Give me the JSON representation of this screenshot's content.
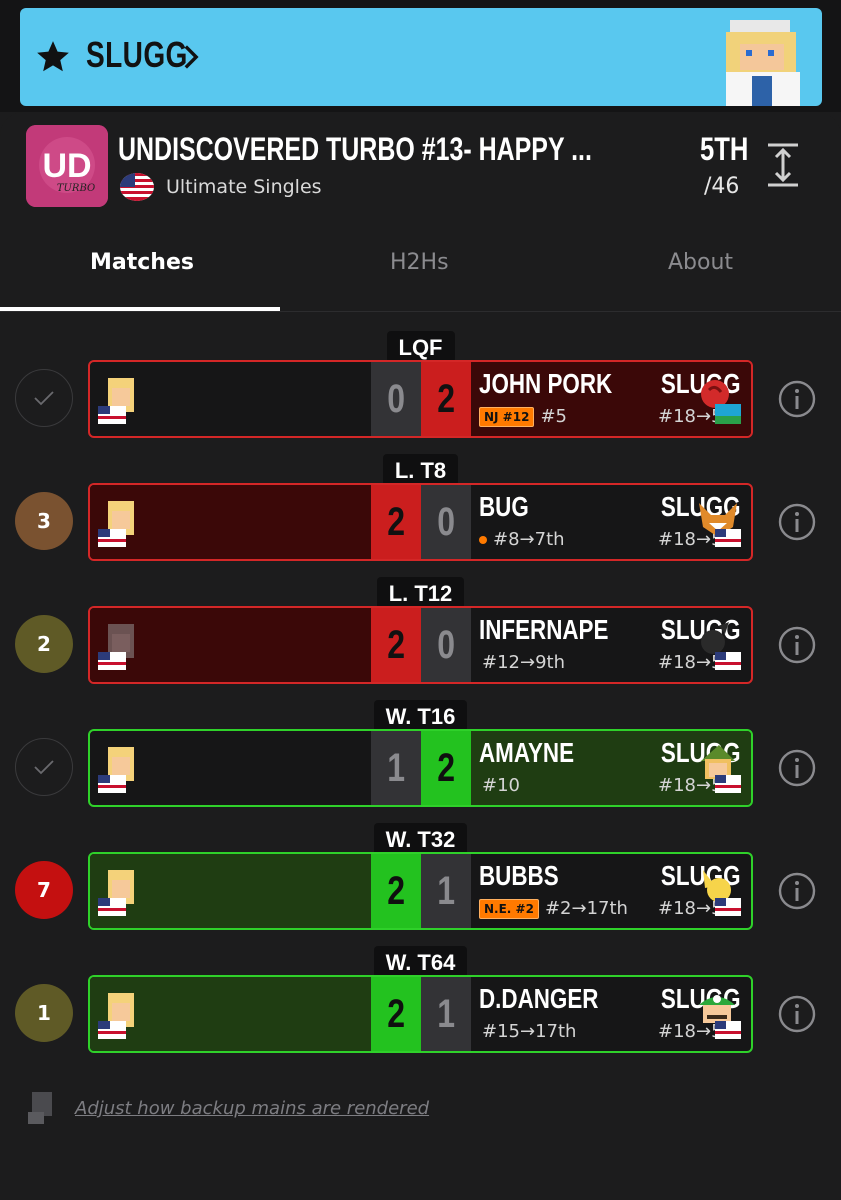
{
  "banner": {
    "name": "SLUGG"
  },
  "event": {
    "logo_text": "UD",
    "logo_sub": "TURBO",
    "title": "UNDISCOVERED TURBO #13- HAPPY ...",
    "game": "Ultimate Singles",
    "place": "5TH",
    "total": "/46"
  },
  "tabs": [
    {
      "label": "Matches",
      "active": true
    },
    {
      "label": "H2Hs",
      "active": false
    },
    {
      "label": "About",
      "active": false
    }
  ],
  "matches": [
    {
      "round": "LQF",
      "indicator": "",
      "indicator_color": "",
      "result": "loss",
      "left": {
        "name": "SLUGG",
        "seed": "#18→5th",
        "score": "0"
      },
      "right": {
        "name": "JOHN PORK",
        "tag": "NJ #12",
        "seed": "#5",
        "score": "2"
      }
    },
    {
      "round": "L. T8",
      "indicator": "3",
      "indicator_color": "#7a5230",
      "result": "win",
      "left": {
        "name": "SLUGG",
        "seed": "#18→5th",
        "score": "2"
      },
      "right": {
        "name": "BUG",
        "tag": "",
        "seed": "#8→7th",
        "score": "0"
      }
    },
    {
      "round": "L. T12",
      "indicator": "2",
      "indicator_color": "#5f5a26",
      "result": "win",
      "left": {
        "name": "SLUGG",
        "seed": "#18→5th",
        "score": "2"
      },
      "right": {
        "name": "INFERNAPE",
        "tag": "",
        "seed": "#12→9th",
        "score": "0"
      }
    },
    {
      "round": "W. T16",
      "indicator": "",
      "indicator_color": "",
      "result": "loss",
      "left": {
        "name": "SLUGG",
        "seed": "#18→5th",
        "score": "1"
      },
      "right": {
        "name": "AMAYNE",
        "tag": "",
        "seed": "#10",
        "score": "2"
      }
    },
    {
      "round": "W. T32",
      "indicator": "7",
      "indicator_color": "#c41010",
      "result": "win",
      "left": {
        "name": "SLUGG",
        "seed": "#18→5th",
        "score": "2"
      },
      "right": {
        "name": "BUBBS",
        "tag": "N.E. #2",
        "seed": "#2→17th",
        "score": "1"
      }
    },
    {
      "round": "W. T64",
      "indicator": "1",
      "indicator_color": "#5f5a26",
      "result": "win",
      "left": {
        "name": "SLUGG",
        "seed": "#18→5th",
        "score": "2"
      },
      "right": {
        "name": "D.DANGER",
        "tag": "",
        "seed": "#15→17th",
        "score": "1"
      }
    }
  ],
  "footer": {
    "link": "Adjust how backup mains are rendered"
  },
  "colors": {
    "banner": "#59c8ef",
    "win": "#23c21f",
    "loss": "#cb1e1e",
    "tag": "#ff7a00"
  }
}
